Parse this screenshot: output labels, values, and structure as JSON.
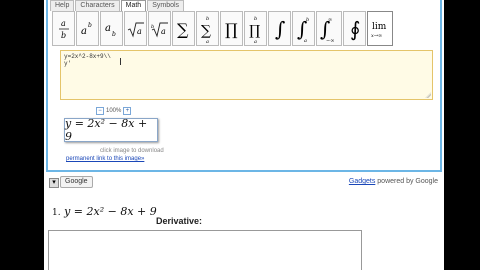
{
  "tabs": [
    "Help",
    "Characters",
    "Math",
    "Symbols"
  ],
  "active_tab": "Math",
  "toolbar_icons": [
    "fraction-icon",
    "superscript-icon",
    "subscript-icon",
    "sqrt-icon",
    "nth-root-icon",
    "sum-icon",
    "sum-limits-icon",
    "product-icon",
    "product-limits-icon",
    "integral-icon",
    "integral-limits-icon",
    "improper-integral-icon",
    "contour-integral-icon",
    "limit-icon"
  ],
  "editor": {
    "line1": "y=2x^2-8x+9\\\\",
    "line2": "y'"
  },
  "zoom": {
    "minus": "−",
    "value": "100%",
    "plus": "+"
  },
  "preview_formula": "y = 2x² − 8x + 9",
  "caption": "click image to download",
  "permalink": "permanent link to this image»",
  "gadget": {
    "google_button": "Google",
    "gadgets_link": "Gadgets",
    "powered_by": " powered by Google"
  },
  "worksheet": {
    "item_number": "1.",
    "equation": "y = 2x² − 8x + 9",
    "derivative_title": "Derivative:"
  }
}
